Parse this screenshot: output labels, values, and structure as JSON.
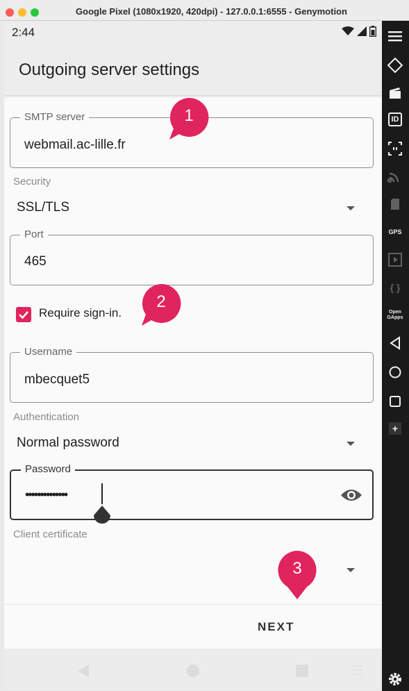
{
  "window": {
    "title": "Google Pixel (1080x1920, 420dpi) - 127.0.0.1:6555 - Genymotion"
  },
  "statusbar": {
    "time": "2:44",
    "icons": [
      "wifi-icon",
      "signal-icon",
      "battery-icon"
    ]
  },
  "appbar": {
    "title": "Outgoing server settings"
  },
  "form": {
    "smtp_server": {
      "label": "SMTP server",
      "value": "webmail.ac-lille.fr"
    },
    "security": {
      "label": "Security",
      "value": "SSL/TLS"
    },
    "port": {
      "label": "Port",
      "value": "465"
    },
    "require_signin": {
      "label": "Require sign-in.",
      "checked": true
    },
    "username": {
      "label": "Username",
      "value": "mbecquet5"
    },
    "authentication": {
      "label": "Authentication",
      "value": "Normal password"
    },
    "password": {
      "label": "Password",
      "masked_value": "••••••••••••••"
    },
    "client_certificate": {
      "label": "Client certificate",
      "value": ""
    }
  },
  "actions": {
    "next_label": "NEXT"
  },
  "annotations": {
    "badge_1": "1",
    "badge_2": "2",
    "badge_3": "3",
    "badge_color": "#e0245e"
  },
  "sidebar": {
    "id_label": "ID",
    "gps_label": "GPS",
    "braces_label": "{ }",
    "opengapps_label": "Open GApps",
    "plus_label": "+"
  },
  "colors": {
    "accent": "#e0245e",
    "toolbar_bg": "#1a1a1a"
  }
}
